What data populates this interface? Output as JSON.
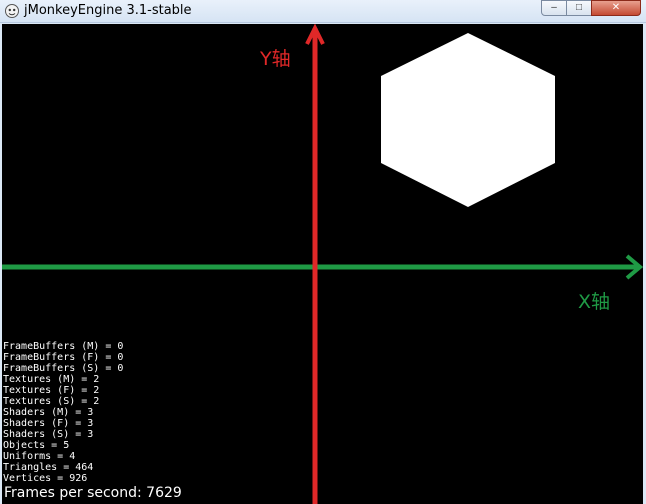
{
  "window": {
    "title": "jMonkeyEngine 3.1-stable",
    "controls": {
      "minimize": "–",
      "maximize": "□",
      "close": "✕"
    }
  },
  "scene": {
    "background": "#000000",
    "y_axis": {
      "label": "Y轴",
      "color": "#e02828"
    },
    "x_axis": {
      "label": "X轴",
      "color": "#1f9a45"
    },
    "shape": {
      "type": "hexagon",
      "color": "#ffffff"
    }
  },
  "stats": [
    "FrameBuffers (M) = 0",
    "FrameBuffers (F) = 0",
    "FrameBuffers (S) = 0",
    "Textures (M) = 2",
    "Textures (F) = 2",
    "Textures (S) = 2",
    "Shaders (M) = 3",
    "Shaders (F) = 3",
    "Shaders (S) = 3",
    "Objects = 5",
    "Uniforms = 4",
    "Triangles = 464",
    "Vertices = 926"
  ],
  "fps": "Frames per second: 7629"
}
